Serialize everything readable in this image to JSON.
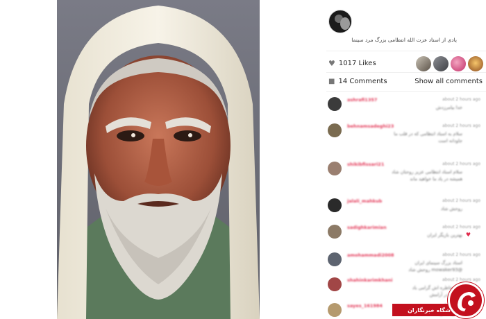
{
  "post": {
    "caption": "یادی از استاد عزت الله انتظامی بزرگ مرد سینما",
    "likes_count": "1017 Likes",
    "comments_count": "14 Comments",
    "show_all_label": "Show all comments"
  },
  "comments": [
    {
      "user": "ashrafi1357",
      "time": "about 2 hours ago",
      "text": "خدا بیامرزدش",
      "text2": "",
      "avatar": "#3b3b3b"
    },
    {
      "user": "behnamsadeghi23",
      "time": "about 2 hours ago",
      "text": "سلام به استاد انتظامی که در قلب ما",
      "text2": "جاودانه است",
      "avatar": "#7a6b50"
    },
    {
      "user": "shikibfissari21",
      "time": "about 2 hours ago",
      "text": "سلام استاد انتظامی عزیز روحتان شاد",
      "text2": "همیشه در یاد ما خواهید ماند",
      "avatar": "#9a7f70"
    },
    {
      "user": "jalali_mahkub",
      "time": "about 2 hours ago",
      "text": "روحش شاد",
      "text2": "",
      "avatar": "#2a2a2a"
    },
    {
      "user": "sadighkarimian",
      "time": "about 2 hours ago",
      "text": "بهترین بازیگر ایران",
      "text2": "",
      "avatar": "#8c7a66",
      "heart": "♥"
    },
    {
      "user": "amohammadi2008",
      "time": "about 2 hours ago",
      "text": "استاد بزرگ سینمای ایران",
      "text2": "@mowaker93 روحش شاد",
      "avatar": "#5d6470"
    },
    {
      "user": "shahinkarimkhani",
      "time": "about 2 hours ago",
      "text": "یاد و خاطره اش گرامی باد",
      "text2": "روحش در آرامش",
      "avatar": "#a14646"
    },
    {
      "user": "sayes_161984",
      "time": "about 2 hours ago",
      "text": "خدا رحمتش کند",
      "text2": "",
      "avatar": "#b59a6e"
    }
  ],
  "watermark": {
    "label": "باشگاه خبرنگاران"
  },
  "colors": {
    "username": "#e33b5a",
    "brand_red": "#c3101e"
  }
}
